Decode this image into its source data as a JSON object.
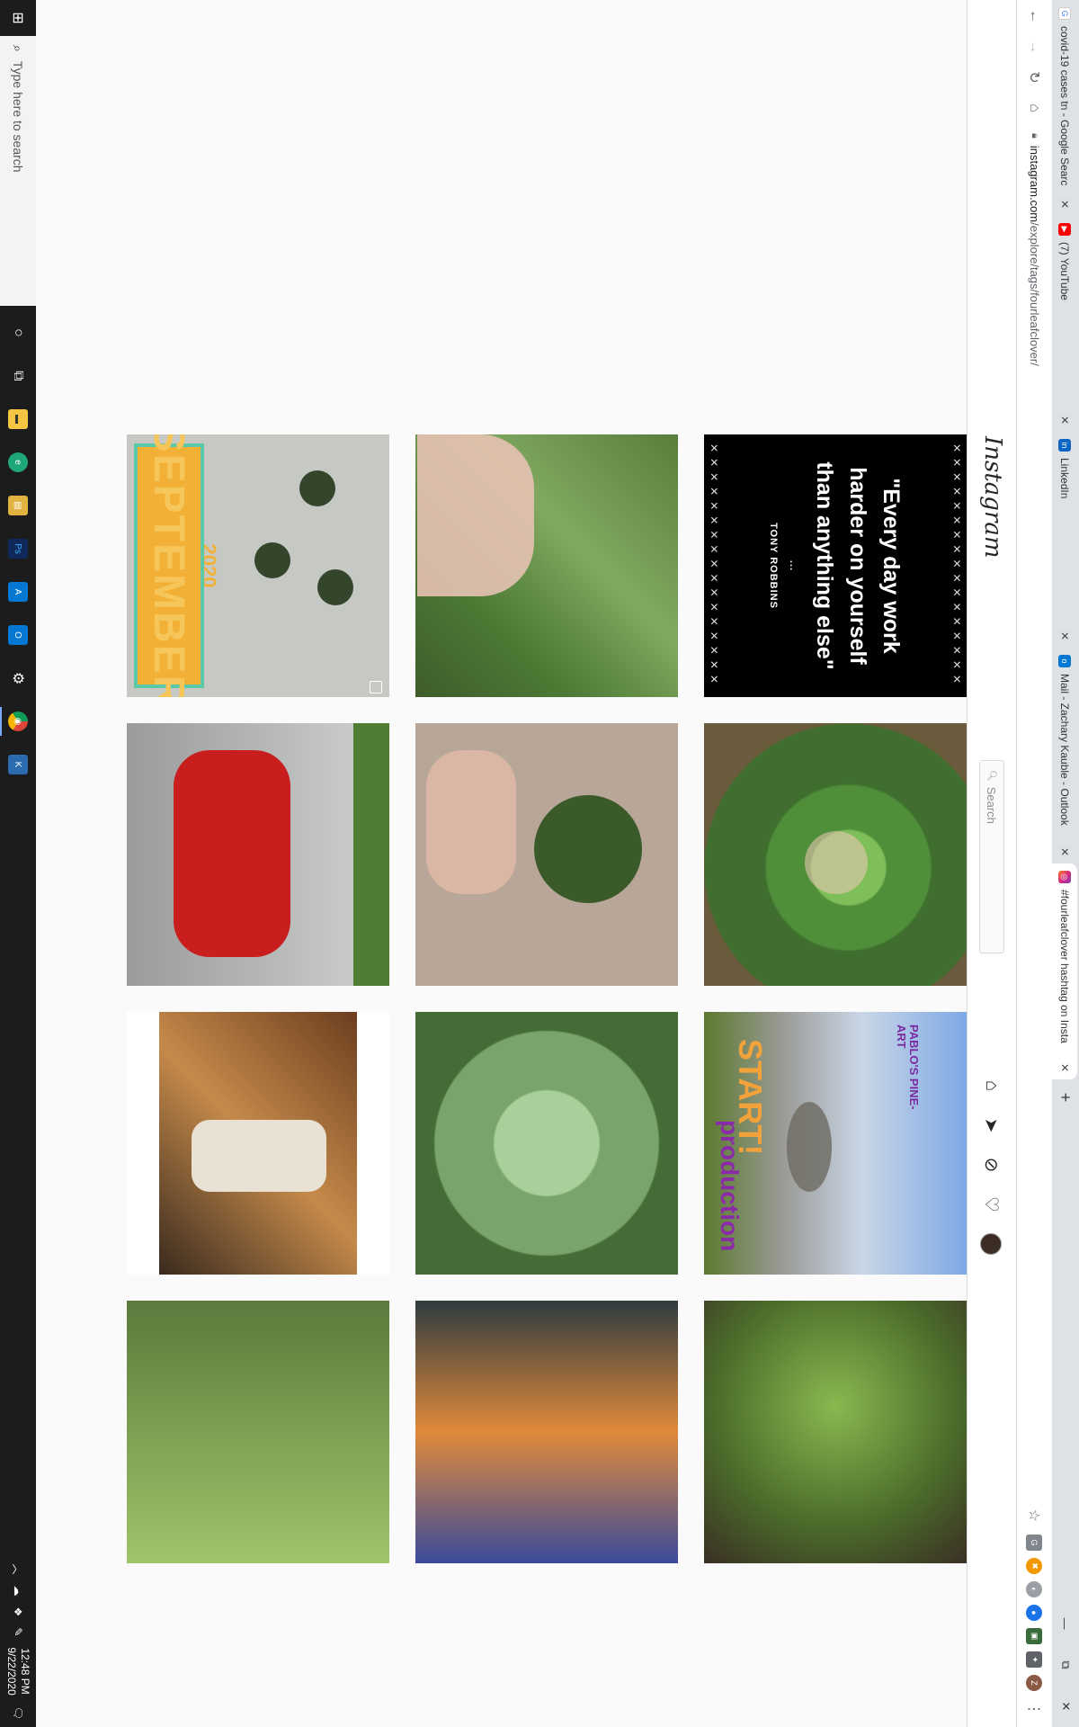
{
  "browser": {
    "tabs": [
      {
        "title": "covid-19 cases tn - Google Searc",
        "favicon": "google-icon",
        "color": "#4285f4"
      },
      {
        "title": "(7) YouTube",
        "favicon": "youtube-icon",
        "color": "#ff0000"
      },
      {
        "title": "LinkedIn",
        "favicon": "linkedin-icon",
        "color": "#0a66c2"
      },
      {
        "title": "Mail - Zachary Kauble - Outlook",
        "favicon": "outlook-icon",
        "color": "#0078d4"
      },
      {
        "title": "#fourleafclover hashtag on Insta",
        "favicon": "instagram-icon",
        "color": "#e1306c"
      }
    ],
    "active_tab_index": 4,
    "url_host": "instagram.com",
    "url_path": "/explore/tags/fourleafclover/",
    "extensions": [
      {
        "name": "profile-avatar",
        "label": "Z",
        "color": "#8a5a44"
      },
      {
        "name": "puzzle-extension-icon",
        "label": "✦",
        "color": "#5f6368"
      },
      {
        "name": "image-extension-icon",
        "label": "▣",
        "color": "#3a6b3a"
      },
      {
        "name": "blue-extension-icon",
        "label": "●",
        "color": "#1a73e8"
      },
      {
        "name": "grey-extension-icon",
        "label": "◐",
        "color": "#9aa0a6"
      },
      {
        "name": "orange-extension-icon",
        "label": "✖",
        "color": "#f29900"
      },
      {
        "name": "g-extension-icon",
        "label": "G",
        "color": "#80868b"
      }
    ]
  },
  "instagram": {
    "logo": "Instagram",
    "search_placeholder": "Search"
  },
  "quote_post": {
    "text": "\"Every day work harder on yourself than anything else\"",
    "dots": "...",
    "author": "TONY ROBBINS"
  },
  "september_post": {
    "year": "2020",
    "month": "SEPTEMBER"
  },
  "production_post": {
    "brand": "PABLO'S PINE-ART",
    "word1": "START!",
    "word2": "production"
  },
  "taskbar": {
    "search_placeholder": "Type here to search",
    "time": "12:48 PM",
    "date": "9/22/2020",
    "apps": [
      {
        "name": "task-view-icon",
        "label": "⧉",
        "color": "transparent"
      },
      {
        "name": "file-explorer-icon",
        "label": "▬",
        "color": "#f4c542"
      },
      {
        "name": "edge-icon",
        "label": "e",
        "color": "#1fa67a"
      },
      {
        "name": "file-folder-icon",
        "label": "▤",
        "color": "#e3b341"
      },
      {
        "name": "photoshop-icon",
        "label": "Ps",
        "color": "#0f2a5a"
      },
      {
        "name": "azure-icon",
        "label": "A",
        "color": "#0078d4"
      },
      {
        "name": "outlook-taskbar-icon",
        "label": "O",
        "color": "#0078d4"
      },
      {
        "name": "settings-icon",
        "label": "⚙",
        "color": "transparent"
      },
      {
        "name": "chrome-icon",
        "label": "◉",
        "color": "#db4437"
      },
      {
        "name": "kite-icon",
        "label": "K",
        "color": "#2b6cb0"
      }
    ]
  }
}
